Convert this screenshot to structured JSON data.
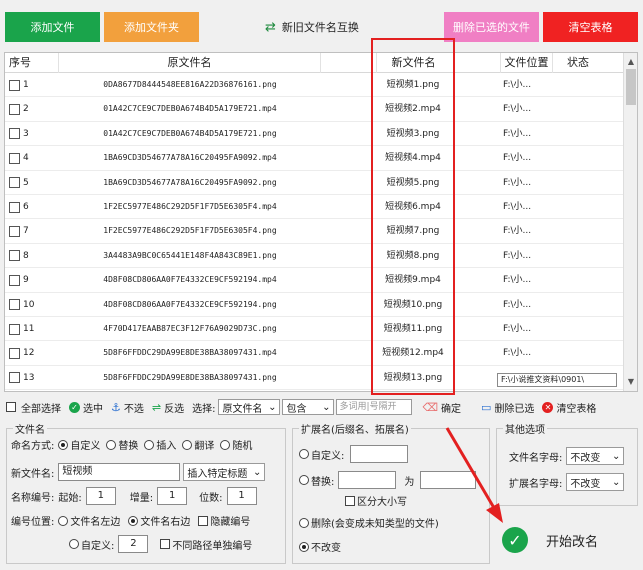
{
  "toolbar": {
    "add_file": "添加文件",
    "add_folder": "添加文件夹",
    "swap_names": "新旧文件名互换",
    "delete_selected": "删除已选的文件",
    "clear_table": "清空表格"
  },
  "colors": {
    "green": "#1aa44b",
    "orange": "#f2a03d",
    "pink": "#f07fc4",
    "red": "#f02222",
    "highlight": "#e32020"
  },
  "table": {
    "columns": [
      "序号",
      "原文件名",
      "新文件名",
      "文件位置",
      "状态"
    ],
    "rows": [
      {
        "idx": "1",
        "orig": "0DA8677D8444548EE816A22D36876161.png",
        "new": "短视频1.png",
        "loc": "F:\\小..."
      },
      {
        "idx": "2",
        "orig": "01A42C7CE9C7DEB0A674B4D5A179E721.mp4",
        "new": "短视频2.mp4",
        "loc": "F:\\小..."
      },
      {
        "idx": "3",
        "orig": "01A42C7CE9C7DEB0A674B4D5A179E721.png",
        "new": "短视频3.png",
        "loc": "F:\\小..."
      },
      {
        "idx": "4",
        "orig": "1BA69CD3D54677A78A16C20495FA9092.mp4",
        "new": "短视频4.mp4",
        "loc": "F:\\小..."
      },
      {
        "idx": "5",
        "orig": "1BA69CD3D54677A78A16C20495FA9092.png",
        "new": "短视频5.png",
        "loc": "F:\\小..."
      },
      {
        "idx": "6",
        "orig": "1F2EC5977E486C292D5F1F7D5E6305F4.mp4",
        "new": "短视频6.mp4",
        "loc": "F:\\小..."
      },
      {
        "idx": "7",
        "orig": "1F2EC5977E486C292D5F1F7D5E6305F4.png",
        "new": "短视频7.png",
        "loc": "F:\\小..."
      },
      {
        "idx": "8",
        "orig": "3A4483A9BC0C65441E148F4A843C89E1.png",
        "new": "短视频8.png",
        "loc": "F:\\小..."
      },
      {
        "idx": "9",
        "orig": "4D8F08CD806AA0F7E4332CE9CF592194.mp4",
        "new": "短视频9.mp4",
        "loc": "F:\\小..."
      },
      {
        "idx": "10",
        "orig": "4D8F08CD806AA0F7E4332CE9CF592194.png",
        "new": "短视频10.png",
        "loc": "F:\\小..."
      },
      {
        "idx": "11",
        "orig": "4F70D417EAAB87EC3F12F76A9029D73C.png",
        "new": "短视频11.png",
        "loc": "F:\\小..."
      },
      {
        "idx": "12",
        "orig": "5D8F6FFDDC29DA99E8DE38BA38097431.mp4",
        "new": "短视频12.mp4",
        "loc": "F:\\小..."
      },
      {
        "idx": "13",
        "orig": "5D8F6FFDDC29DA99E8DE38BA38097431.png",
        "new": "短视频13.png",
        "loc": ""
      }
    ],
    "tooltip": "F:\\小说推文资料\\0901\\"
  },
  "actions": {
    "select_all": "全部选择",
    "select": "选中",
    "deselect": "不选",
    "invert": "反选",
    "choose_label": "选择:",
    "field_select": "原文件名",
    "match_select": "包含",
    "filter_placeholder": "多词用|号隔开",
    "confirm": "确定",
    "delete_selected": "删除已选",
    "clear_table": "清空表格"
  },
  "filename_group": {
    "title": "文件名",
    "naming_mode_label": "命名方式:",
    "modes": [
      "自定义",
      "替换",
      "插入",
      "翻译",
      "随机"
    ],
    "new_name_label": "新文件名:",
    "new_name_value": "短视频",
    "insert_title_select": "插入特定标题",
    "numbering_label": "名称编号:",
    "start_label": "起始:",
    "start_value": "1",
    "increment_label": "增量:",
    "increment_value": "1",
    "digits_label": "位数:",
    "digits_value": "1",
    "position_label": "编号位置:",
    "pos_left": "文件名左边",
    "pos_right": "文件名右边",
    "hide_number": "隐藏编号",
    "custom_label": "自定义:",
    "custom_value": "2",
    "separate_path": "不同路径单独编号"
  },
  "ext_group": {
    "title": "扩展名(后缀名、拓展名)",
    "custom": "自定义:",
    "replace": "替换:",
    "to_label": "为",
    "case_sensitive": "区分大小写",
    "delete_option": "删除(会变成未知类型的文件)",
    "no_change": "不改变"
  },
  "other_group": {
    "title": "其他选项",
    "filename_case_label": "文件名字母:",
    "filename_case_value": "不改变",
    "ext_case_label": "扩展名字母:",
    "ext_case_value": "不改变"
  },
  "start_button": "开始改名"
}
